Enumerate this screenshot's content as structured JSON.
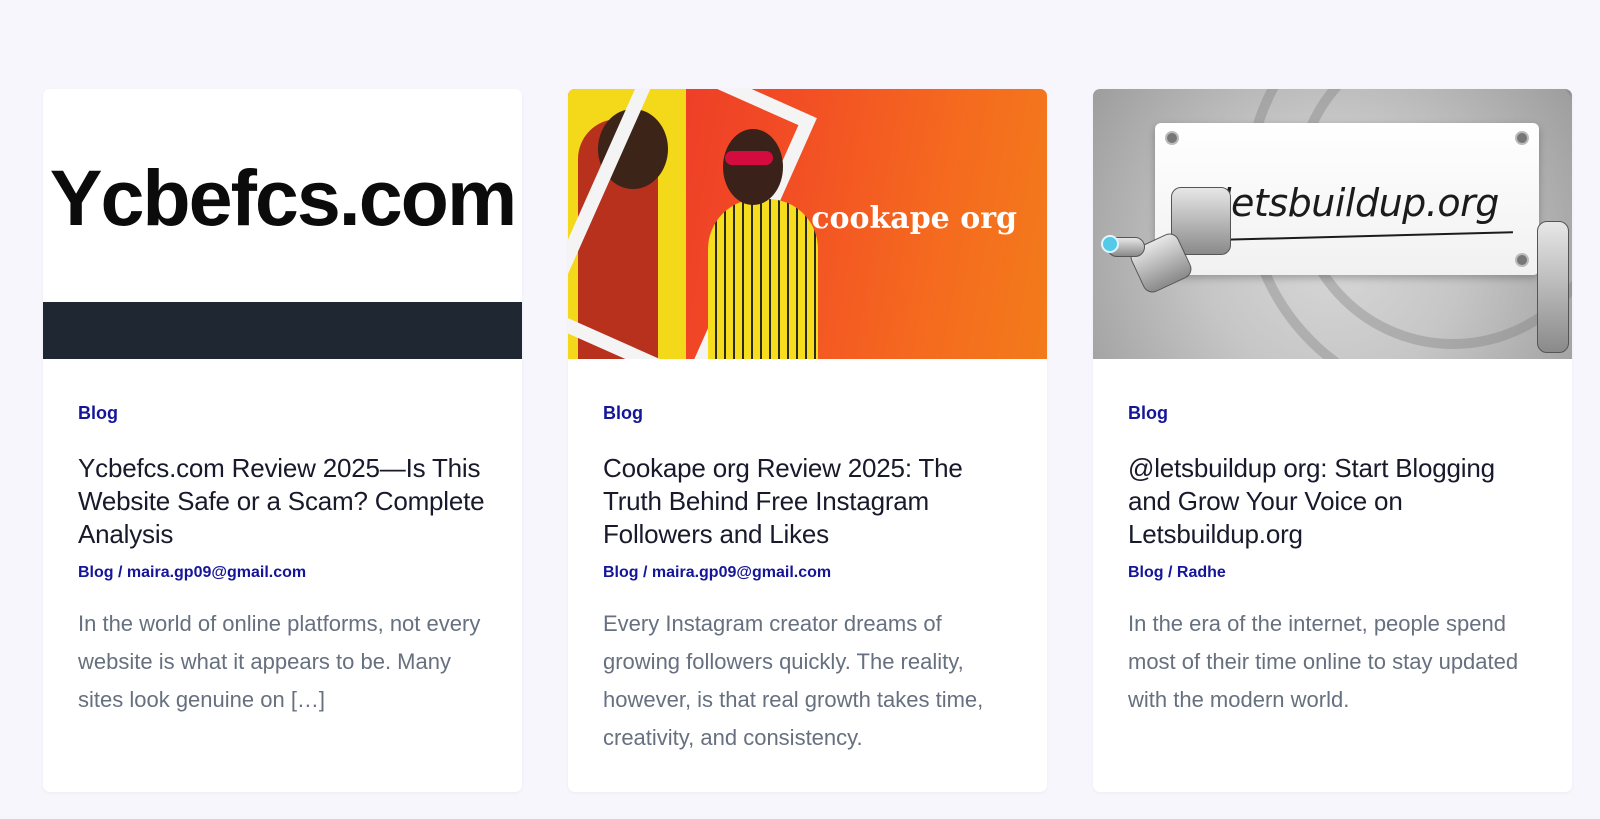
{
  "cards": [
    {
      "thumbnail_text": "Ycbefcs.com",
      "category": "Blog",
      "title": "Ycbefcs.com Review 2025—Is This Website Safe or a Scam? Complete Analysis",
      "meta_category": "Blog",
      "meta_separator": " / ",
      "author": "maira.gp09@gmail.com",
      "excerpt": "In the world of online platforms, not every website is what it appears to be. Many sites look genuine on […]"
    },
    {
      "thumbnail_text": "cookape org",
      "category": "Blog",
      "title": "Cookape org Review 2025: The Truth Behind Free Instagram Followers and Likes",
      "meta_category": "Blog",
      "meta_separator": " / ",
      "author": "maira.gp09@gmail.com",
      "excerpt": "Every Instagram creator dreams of growing followers quickly. The reality, however, is that real growth takes time, creativity, and consistency."
    },
    {
      "thumbnail_text": "letsbuildup.org",
      "category": "Blog",
      "title": "@letsbuildup org: Start Blogging and Grow Your Voice on Letsbuildup.org",
      "meta_category": "Blog",
      "meta_separator": " / ",
      "author": "Radhe",
      "excerpt": "In the era of the internet, people spend most of their time online to stay updated with the modern world."
    }
  ],
  "colors": {
    "page_background": "#f7f6fc",
    "link": "#15159a",
    "title": "#18192b",
    "excerpt": "#66707f",
    "thumb1_bar": "#1f2733"
  }
}
